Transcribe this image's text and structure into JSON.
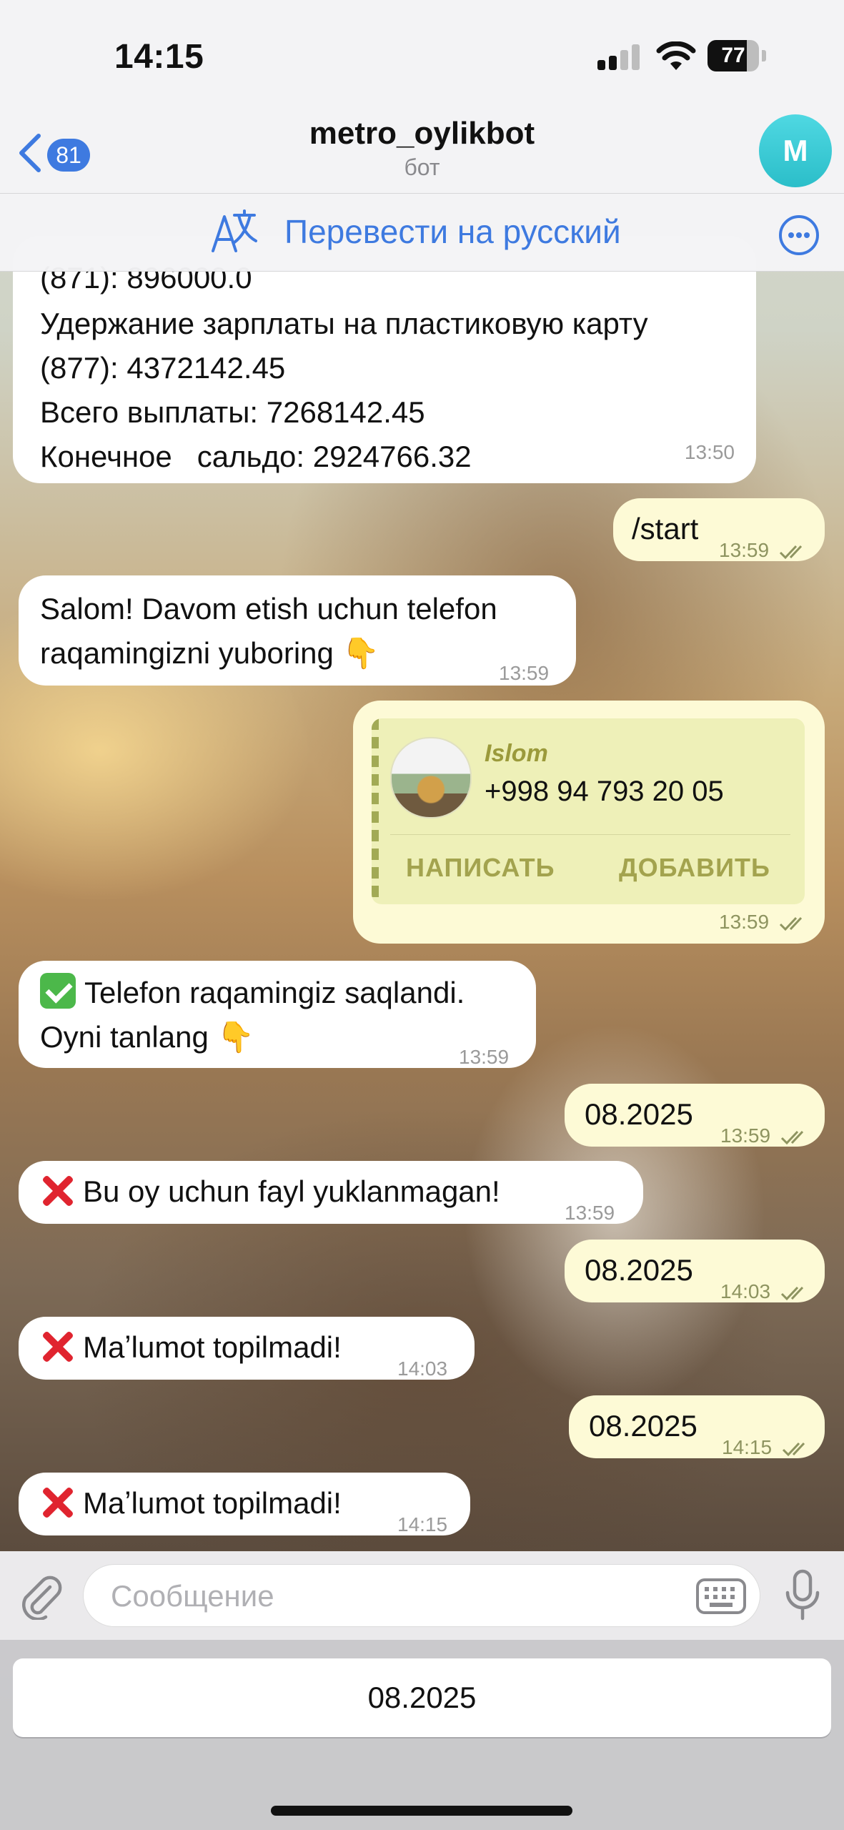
{
  "status_bar": {
    "time": "14:15",
    "battery": "77",
    "battery_level": 0.77
  },
  "header": {
    "back_count": "81",
    "title": "metro_oylikbot",
    "subtitle": "бот",
    "avatar_letter": "M"
  },
  "translate_bar": {
    "label": "Перевести на русский"
  },
  "messages": [
    {
      "direction": "in",
      "lines": [
        "(871): 896000.0",
        "Удержание зарплаты на пластиковую карту",
        "(877): 4372142.45",
        "Всего выплаты: 7268142.45",
        "Конечное   сальдо: 2924766.32"
      ],
      "time": "13:50"
    },
    {
      "direction": "out",
      "text": "/start",
      "time": "13:59"
    },
    {
      "direction": "in",
      "lines": [
        "Salom! Davom etish uchun telefon",
        "raqamingizni yuboring 👇"
      ],
      "time": "13:59"
    },
    {
      "direction": "out",
      "type": "contact",
      "name": "Islom",
      "phone": "+998 94 793 20 05",
      "write_label": "НАПИСАТЬ",
      "add_label": "ДОБАВИТЬ",
      "time": "13:59"
    },
    {
      "direction": "in",
      "lines": [
        "Telefon raqamingiz saqlandi.",
        "Oyni tanlang 👇"
      ],
      "emoji": "check",
      "time": "13:59"
    },
    {
      "direction": "out",
      "text": "08.2025",
      "time": "13:59"
    },
    {
      "direction": "in",
      "text": "Bu oy uchun fayl yuklanmagan!",
      "emoji": "cross",
      "time": "13:59"
    },
    {
      "direction": "out",
      "text": "08.2025",
      "time": "14:03"
    },
    {
      "direction": "in",
      "text": "Maʼlumot topilmadi!",
      "emoji": "cross",
      "time": "14:03"
    },
    {
      "direction": "out",
      "text": "08.2025",
      "time": "14:15"
    },
    {
      "direction": "in",
      "text": "Maʼlumot topilmadi!",
      "emoji": "cross",
      "time": "14:15"
    }
  ],
  "composer": {
    "placeholder": "Сообщение",
    "value": ""
  },
  "reply_keyboard": {
    "buttons": [
      "08.2025"
    ]
  },
  "colors": {
    "accent": "#3e7ae0",
    "outgoing_bubble": "#fdfad6",
    "incoming_bubble": "#ffffff",
    "avatar": "#2bbec9",
    "cross": "#e0242f",
    "check": "#4cb84a"
  },
  "icons": [
    "back-chevron-icon",
    "translate-icon",
    "more-icon",
    "attach-icon",
    "keyboard-icon",
    "microphone-icon",
    "read-ticks-icon"
  ]
}
